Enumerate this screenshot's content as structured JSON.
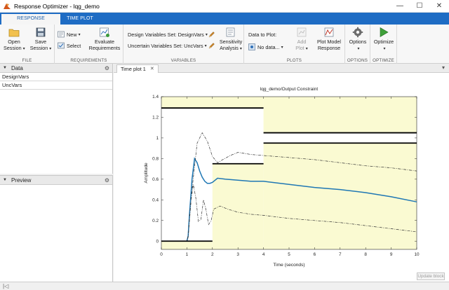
{
  "window": {
    "title": "Response Optimizer - lqg_demo",
    "controls": [
      "—",
      "☐",
      "✕"
    ]
  },
  "ribbon_tabs": [
    {
      "label": "RESPONSE OPTIMIZATION",
      "active": true
    },
    {
      "label": "TIME PLOT",
      "active": false
    }
  ],
  "ribbon": {
    "file": {
      "label": "FILE",
      "open_session": "Open\nSession",
      "save_session": "Save\nSession"
    },
    "requirements": {
      "label": "REQUIREMENTS",
      "new": "New",
      "select": "Select",
      "evaluate": "Evaluate\nRequirements"
    },
    "variables": {
      "label": "VARIABLES",
      "design_vars": "Design Variables Set: DesignVars",
      "uncertain_vars": "Uncertain Variables Set: UncVars",
      "sensitivity": "Sensitivity\nAnalysis"
    },
    "plots": {
      "label": "PLOTS",
      "data_to_plot": "Data to Plot:",
      "no_data": "No data...",
      "add_plot": "Add Plot",
      "plot_model_response": "Plot Model\nResponse"
    },
    "options": {
      "label": "OPTIONS",
      "options": "Options"
    },
    "optimize": {
      "label": "OPTIMIZE",
      "optimize": "Optimize"
    }
  },
  "data_panel": {
    "title": "Data",
    "variables": [
      "DesignVars",
      "UncVars"
    ]
  },
  "preview_panel": {
    "title": "Preview"
  },
  "doc_tab": {
    "label": "Time plot 1"
  },
  "update_block": "Update block",
  "colors": {
    "ribbon_blue": "#1e6cc4",
    "constraint_fill": "#fafad2",
    "nominal_line": "#1f77b4",
    "bound_line": "#000000"
  },
  "chart_data": {
    "type": "line",
    "title": "lqg_demo/Output  Constraint",
    "xlabel": "Time (seconds)",
    "ylabel": "Amplitude",
    "xlim": [
      0,
      10
    ],
    "ylim": [
      -0.08,
      1.4
    ],
    "xticks": [
      0,
      1,
      2,
      3,
      4,
      5,
      6,
      7,
      8,
      9,
      10
    ],
    "yticks": [
      0,
      0.2,
      0.4,
      0.6,
      0.8,
      1,
      1.2,
      1.4
    ],
    "grid": false,
    "regions": [
      {
        "x": [
          0,
          4
        ],
        "y": [
          1.29,
          1.4
        ],
        "name": "upper bound 0-4"
      },
      {
        "x": [
          2,
          4
        ],
        "y": [
          -0.08,
          0.75
        ],
        "name": "lower bound 2-4"
      },
      {
        "x": [
          4,
          10
        ],
        "y": [
          1.05,
          1.4
        ],
        "name": "upper bound 4-10"
      },
      {
        "x": [
          4,
          10
        ],
        "y": [
          -0.08,
          0.95
        ],
        "name": "lower bound 4-10"
      },
      {
        "x": [
          0,
          2
        ],
        "y": [
          -0.08,
          0.0
        ],
        "name": "lower bound 0-2"
      }
    ],
    "bounds": [
      {
        "x": [
          0,
          4
        ],
        "y": [
          1.29,
          1.29
        ]
      },
      {
        "x": [
          0,
          2
        ],
        "y": [
          0.0,
          0.0
        ]
      },
      {
        "x": [
          2,
          4
        ],
        "y": [
          0.75,
          0.75
        ]
      },
      {
        "x": [
          4,
          10
        ],
        "y": [
          1.05,
          1.05
        ]
      },
      {
        "x": [
          4,
          10
        ],
        "y": [
          0.95,
          0.95
        ]
      }
    ],
    "series": [
      {
        "style": "nominal",
        "x": [
          0,
          0.5,
          1.0,
          1.05,
          1.1,
          1.2,
          1.3,
          1.4,
          1.5,
          1.6,
          1.7,
          1.8,
          1.9,
          2.0,
          2.2,
          2.5,
          3.0,
          3.5,
          4.0,
          5.0,
          6.0,
          7.0,
          8.0,
          9.0,
          10.0
        ],
        "y": [
          0,
          0,
          0,
          0.05,
          0.25,
          0.6,
          0.8,
          0.76,
          0.68,
          0.62,
          0.58,
          0.56,
          0.56,
          0.57,
          0.61,
          0.6,
          0.59,
          0.58,
          0.58,
          0.55,
          0.52,
          0.5,
          0.47,
          0.43,
          0.38
        ]
      },
      {
        "style": "uncertain-upper",
        "x": [
          0,
          1.0,
          1.05,
          1.2,
          1.4,
          1.6,
          1.8,
          2.0,
          2.2,
          2.4,
          2.7,
          3.0,
          3.5,
          4.0,
          5.0,
          6.0,
          7.0,
          8.0,
          9.0,
          10.0
        ],
        "y": [
          0,
          0,
          0.05,
          0.5,
          0.95,
          1.05,
          0.97,
          0.82,
          0.76,
          0.79,
          0.83,
          0.86,
          0.84,
          0.83,
          0.81,
          0.79,
          0.76,
          0.73,
          0.71,
          0.68
        ]
      },
      {
        "style": "uncertain-lower",
        "x": [
          0,
          1.0,
          1.05,
          1.15,
          1.25,
          1.35,
          1.45,
          1.55,
          1.65,
          1.75,
          1.85,
          1.95,
          2.05,
          2.3,
          2.6,
          3.0,
          3.5,
          4.0,
          5.0,
          6.0,
          7.0,
          8.0,
          9.0,
          10.0
        ],
        "y": [
          0,
          0,
          0.04,
          0.38,
          0.55,
          0.42,
          0.19,
          0.21,
          0.4,
          0.3,
          0.16,
          0.2,
          0.31,
          0.34,
          0.31,
          0.28,
          0.26,
          0.25,
          0.22,
          0.2,
          0.18,
          0.15,
          0.12,
          0.09
        ]
      }
    ]
  }
}
